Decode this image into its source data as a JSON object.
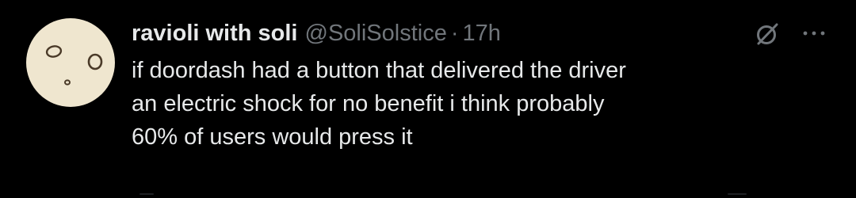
{
  "tweet": {
    "display_name": "ravioli with soli",
    "handle": "@SoliSolstice",
    "separator": "·",
    "time": "17h",
    "text_lines": [
      "if doordash had a button that delivered the driver",
      "an electric shock for no benefit i think probably",
      "60% of users would press it"
    ]
  },
  "icons": {
    "avatar": "ravioli-face-avatar",
    "grok": "grok-icon",
    "more": "more-dots-icon"
  },
  "colors": {
    "background": "#000000",
    "primary_text": "#e7e9ea",
    "secondary_text": "#71767b",
    "avatar_fill": "#efe6cf"
  }
}
